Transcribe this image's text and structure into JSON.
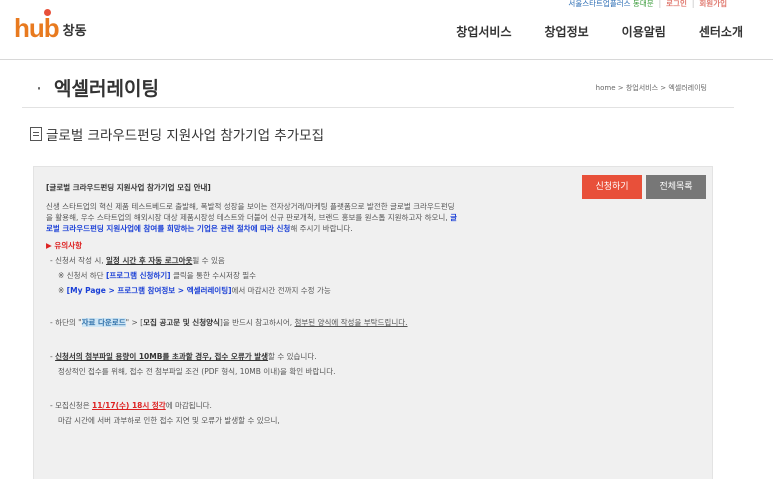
{
  "topbar": {
    "org_a": "서울스타트업플러스",
    "org_b": "동대문",
    "login": "로그인",
    "signup": "회원가입"
  },
  "logo": {
    "hub": "hub",
    "city": "창동"
  },
  "nav": {
    "items": [
      {
        "label": "창업서비스"
      },
      {
        "label": "창업정보"
      },
      {
        "label": "이용알림"
      },
      {
        "label": "센터소개"
      }
    ]
  },
  "page": {
    "title": "엑셀러레이팅",
    "breadcrumb": "home > 창업서비스 > 엑셀러레이팅",
    "subtitle": "글로벌 크라우드펀딩 지원사업 참가기업 추가모집"
  },
  "buttons": {
    "apply": "신청하기",
    "list": "전체목록"
  },
  "content": {
    "heading": "[글로벌 크라우드펀딩 지원사업 참가기업 모집 안내]",
    "intro_1": "신생 스타트업의 혁신 제품 테스트베드로 출발해, 폭발적 성장을 보이는 전자상거래/마케팅 플랫폼으로 발전한 글로벌 크라우드펀딩",
    "intro_2": "을 활용해, 우수 스타트업의 해외시장 대상 제품시장성 테스트와 더불어 신규 판로개척, 브랜드 홍보를 원스톱 지원하고자 하오니,",
    "intro_2_blue": "글",
    "intro_3_blue": "로벌 크라우드펀딩 지원사업에 참여를 희망하는 기업은 관련 절차에 따라 신청",
    "intro_3_end": "해 주시기 바랍니다.",
    "notice_heading": "▶ 유의사항",
    "n1_pre": "- 신청서 작성 시, ",
    "n1_bold": "일정 시간 후 자동 로그아웃",
    "n1_post": "될 수 있음",
    "n1a_pre": "※ 신청서 하단 ",
    "n1a_bold": "[프로그램 신청하기]",
    "n1a_post": " 클릭을 통한 수시저장 필수",
    "n1b_pre": "※ ",
    "n1b_bold": "[My Page > 프로그램 참여정보 > 엑셀러레이팅]",
    "n1b_post": "에서 마감시간 전까지 수정 가능",
    "n2_pre": "- 하단의 \"",
    "n2_hl": "자료 다운로드",
    "n2_mid": "\" > [",
    "n2_bold": "모집 공고문 및 신청양식",
    "n2_post": "]을 반드시 참고하시어, ",
    "n2_ul": "첨부된 양식에 작성을 부탁드립니다.",
    "n3_pre": "- ",
    "n3_bold": "신청서의 첨부파일 용량이 10MB를 초과할 경우, 접수 오류가 발생",
    "n3_post": "할 수 있습니다.",
    "n3_line2": "정상적인 접수를 위해, 접수 전 첨부파일 조건 (PDF 형식, 10MB 이내)을 확인 바랍니다.",
    "n4_pre": "- 모집신청은 ",
    "n4_red": "11/17(수) 18시 정각",
    "n4_post": "에 마감됩니다.",
    "n4_line2": "마감 시간에 서버 과부하로 인한 접수 지연 및 오류가 발생할 수 있으니,"
  }
}
